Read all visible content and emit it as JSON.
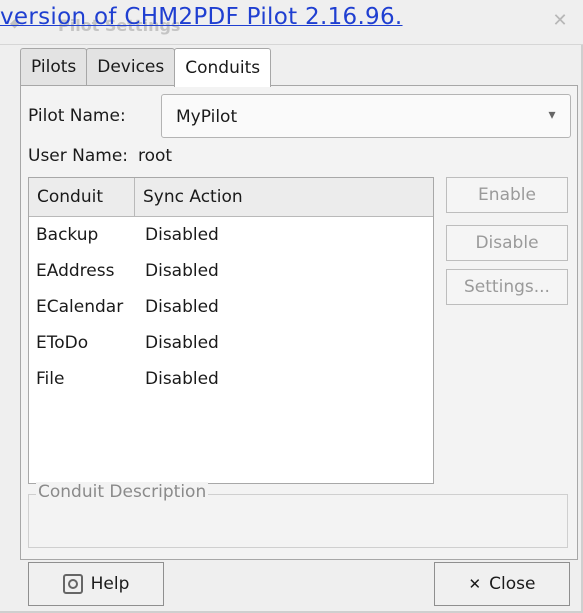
{
  "window": {
    "title_ghost": "Pilot Settings",
    "overlay_link": "version of CHM2PDF Pilot 2.16.96."
  },
  "tabs": [
    {
      "label": "Pilots"
    },
    {
      "label": "Devices"
    },
    {
      "label": "Conduits"
    }
  ],
  "form": {
    "pilot_name_label": "Pilot Name:",
    "pilot_name_value": "MyPilot",
    "user_name_label": "User Name:",
    "user_name_value": "root"
  },
  "table": {
    "headers": [
      "Conduit",
      "Sync Action"
    ],
    "rows": [
      {
        "conduit": "Backup",
        "action": "Disabled"
      },
      {
        "conduit": "EAddress",
        "action": "Disabled"
      },
      {
        "conduit": "ECalendar",
        "action": "Disabled"
      },
      {
        "conduit": "EToDo",
        "action": "Disabled"
      },
      {
        "conduit": "File",
        "action": "Disabled"
      }
    ]
  },
  "side_buttons": {
    "enable": "Enable",
    "disable": "Disable",
    "settings": "Settings..."
  },
  "description": {
    "legend": "Conduit Description"
  },
  "buttons": {
    "help": "Help",
    "close": "Close"
  },
  "colors": {
    "link": "#1f3fd1",
    "disabled_text": "#9a9a9a"
  }
}
